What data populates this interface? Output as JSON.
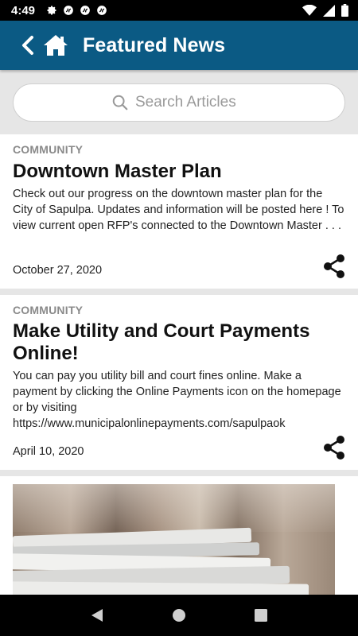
{
  "status_bar": {
    "time": "4:49"
  },
  "app_bar": {
    "title": "Featured News",
    "background": "#0b5a84"
  },
  "search": {
    "placeholder": "Search Articles"
  },
  "articles": [
    {
      "category": "COMMUNITY",
      "title": "Downtown Master Plan",
      "summary": "Check out our progress on the downtown master plan for the City of Sapulpa. Updates and information will be posted here ! To view current open RFP's connected to the Downtown Master . . .",
      "date": "October 27, 2020"
    },
    {
      "category": "COMMUNITY",
      "title": "Make Utility and Court Payments Online!",
      "summary": "You can pay you utility bill and court fines online. Make a payment by clicking the Online Payments icon on the homepage or by visiting  https://www.municipalonlinepayments.com/sapulpaok",
      "date": "April 10, 2020"
    }
  ],
  "icons": {
    "back": "chevron-left-icon",
    "home": "home-icon",
    "search": "search-icon",
    "share": "share-icon",
    "nav_back": "triangle-back-icon",
    "nav_home": "circle-home-icon",
    "nav_recents": "square-recents-icon"
  }
}
